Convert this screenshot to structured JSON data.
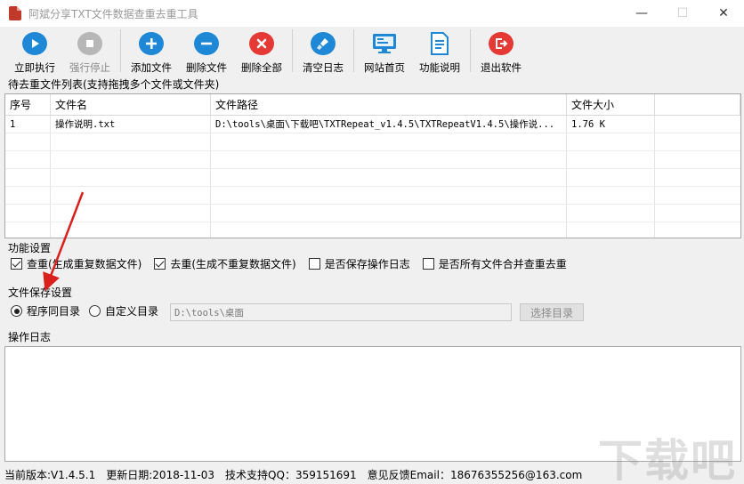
{
  "window": {
    "title": "阿斌分享TXT文件数据查重去重工具",
    "controls": [
      "—",
      "☐",
      "✕"
    ]
  },
  "toolbar": {
    "buttons": [
      {
        "label": "立即执行",
        "icon": "play-icon",
        "color": "#1e88d6"
      },
      {
        "label": "强行停止",
        "icon": "stop-icon",
        "color": "#b7b7b7"
      },
      {
        "label": "添加文件",
        "icon": "plus-icon",
        "color": "#1e88d6"
      },
      {
        "label": "删除文件",
        "icon": "minus-icon",
        "color": "#1e88d6"
      },
      {
        "label": "删除全部",
        "icon": "close-icon",
        "color": "#e53935"
      },
      {
        "label": "清空日志",
        "icon": "brush-icon",
        "color": "#1e88d6"
      },
      {
        "label": "网站首页",
        "icon": "monitor-icon",
        "color": "#1e88d6"
      },
      {
        "label": "功能说明",
        "icon": "document-icon",
        "color": "#1e88d6"
      },
      {
        "label": "退出软件",
        "icon": "exit-icon",
        "color": "#e53935"
      }
    ]
  },
  "file_list": {
    "label": "待去重文件列表(支持拖拽多个文件或文件夹)",
    "columns": [
      "序号",
      "文件名",
      "文件路径",
      "文件大小"
    ],
    "rows": [
      {
        "index": "1",
        "name": "操作说明.txt",
        "path": "D:\\tools\\桌面\\下载吧\\TXTRepeat_v1.4.5\\TXTRepeatV1.4.5\\操作说...",
        "size": "1.76 K"
      }
    ]
  },
  "features": {
    "label": "功能设置",
    "options": [
      {
        "label": "查重(生成重复数据文件)",
        "checked": true
      },
      {
        "label": "去重(生成不重复数据文件)",
        "checked": true
      },
      {
        "label": "是否保存操作日志",
        "checked": false
      },
      {
        "label": "是否所有文件合并查重去重",
        "checked": false
      }
    ]
  },
  "save": {
    "label": "文件保存设置",
    "options": [
      {
        "label": "程序同目录",
        "selected": true
      },
      {
        "label": "自定义目录",
        "selected": false
      }
    ],
    "dir_value": "D:\\tools\\桌面",
    "choose_label": "选择目录"
  },
  "log": {
    "label": "操作日志"
  },
  "status": {
    "version": "当前版本:V1.4.5.1",
    "date": "更新日期:2018-11-03",
    "qq": "技术支持QQ：359151691",
    "feedback": "意见反馈Email：18676355256@163.com"
  },
  "watermark": "下载吧",
  "colors": {
    "accent_blue": "#1e88d6",
    "danger_red": "#e53935",
    "annotation_red": "#d9201c"
  }
}
